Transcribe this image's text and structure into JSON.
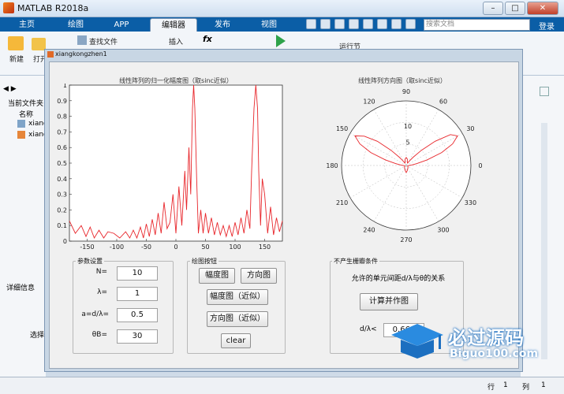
{
  "app": {
    "title": "MATLAB R2018a",
    "tabs": [
      "主页",
      "绘图",
      "APP",
      "编辑器",
      "发布",
      "视图"
    ],
    "active_tab": "编辑器",
    "search_placeholder": "搜索文档",
    "login": "登录",
    "toolstrip": {
      "new": "新建",
      "open": "打开",
      "find_files": "查找文件",
      "insert": "插入",
      "run_section": "运行节"
    },
    "current_folder_label": "当前文件夹",
    "name_col": "名称",
    "files": [
      "xiang",
      "xiang"
    ],
    "details_label": "详细信息",
    "select_hint": "选择",
    "status": {
      "row_label": "行",
      "row": "1",
      "col_label": "列",
      "col": "1"
    }
  },
  "figure": {
    "title": "xiangkongzhen1",
    "amp_plot": {
      "title": "线性阵列的归一化幅度图（取sinc近似）",
      "x_ticks": [
        "-150",
        "-100",
        "-50",
        "0",
        "50",
        "100",
        "150"
      ],
      "y_ticks": [
        "0",
        "0.1",
        "0.2",
        "0.3",
        "0.4",
        "0.5",
        "0.6",
        "0.7",
        "0.8",
        "0.9",
        "1"
      ]
    },
    "polar_plot": {
      "title": "线性阵列方向图（取sinc近似）",
      "angle_labels": [
        "90",
        "60",
        "30",
        "0",
        "330",
        "300",
        "270",
        "240",
        "210",
        "180",
        "150",
        "120"
      ],
      "radial_labels": [
        "5",
        "10"
      ]
    },
    "params": {
      "group_label": "参数设置",
      "N_label": "N=",
      "N_value": "10",
      "lambda_label": "λ=",
      "lambda_value": "1",
      "a_label": "a=d/λ=",
      "a_value": "0.5",
      "theta_label": "θB=",
      "theta_value": "30"
    },
    "buttons": {
      "group_label": "绘图按钮",
      "amp": "幅度图",
      "dir": "方向图",
      "amp_approx": "幅度图（近似）",
      "dir_approx": "方向图（近似）",
      "clear": "clear"
    },
    "grating": {
      "group_label": "不产生栅瓣条件",
      "desc": "允许的单元间距d/λ与θ的关系",
      "compute": "计算并作图",
      "dl_label": "d/λ<",
      "dl_value": "0.666"
    }
  },
  "watermark": {
    "text_cn": "必过源码",
    "text_en": "Biguo100.com"
  },
  "colors": {
    "accent": "#0b5ea6",
    "curve": "#e8262b"
  },
  "chart_data": [
    {
      "type": "line",
      "title": "线性阵列的归一化幅度图（取sinc近似）",
      "xlim": [
        -180,
        180
      ],
      "ylim": [
        0,
        1
      ],
      "series": [
        {
          "x": [
            -180,
            -170,
            -160,
            -152,
            -145,
            -138,
            -130,
            -122,
            -115,
            -105,
            -95,
            -85,
            -78,
            -72,
            -66,
            -60,
            -55,
            -50,
            -45,
            -40,
            -35,
            -30,
            -25,
            -20,
            -15,
            -10,
            -5,
            0,
            5,
            10,
            15,
            18,
            22,
            25,
            28,
            30,
            32,
            35,
            38,
            42,
            46,
            50,
            55,
            60,
            65,
            70,
            75,
            80,
            85,
            90,
            95,
            100,
            105,
            110,
            115,
            120,
            125,
            128,
            132,
            135,
            138,
            140,
            143,
            146,
            150,
            155,
            160,
            165,
            170,
            175,
            180
          ],
          "y": [
            0.13,
            0.05,
            0.1,
            0.03,
            0.09,
            0.02,
            0.07,
            0.02,
            0.06,
            0.05,
            0.02,
            0.06,
            0.02,
            0.07,
            0.02,
            0.09,
            0.02,
            0.11,
            0.03,
            0.14,
            0.04,
            0.18,
            0.05,
            0.25,
            0.08,
            0.12,
            0.3,
            0.05,
            0.35,
            0.1,
            0.45,
            0.2,
            0.6,
            0.3,
            0.85,
            1.0,
            0.85,
            0.4,
            0.05,
            0.2,
            0.05,
            0.18,
            0.05,
            0.15,
            0.04,
            0.12,
            0.04,
            0.1,
            0.03,
            0.1,
            0.03,
            0.12,
            0.04,
            0.15,
            0.05,
            0.2,
            0.08,
            0.45,
            0.85,
            1.0,
            0.85,
            0.45,
            0.1,
            0.4,
            0.3,
            0.05,
            0.22,
            0.04,
            0.15,
            0.06,
            0.13
          ]
        }
      ]
    },
    {
      "type": "line",
      "title": "线性阵列方向图（取sinc近似）",
      "rlim": [
        0,
        12
      ],
      "series": [
        {
          "theta": [
            0,
            5,
            10,
            15,
            20,
            25,
            30,
            35,
            40,
            45,
            50,
            55,
            60,
            70,
            80,
            90,
            100,
            110,
            120,
            125,
            130,
            135,
            140,
            145,
            150,
            155,
            160,
            165,
            170,
            175,
            180,
            200,
            230,
            260,
            270,
            280,
            310,
            340,
            360
          ],
          "r": [
            0.5,
            1.0,
            2.0,
            4.0,
            7.0,
            9.5,
            11.0,
            10.0,
            7.0,
            4.0,
            2.0,
            1.0,
            0.5,
            0.6,
            1.2,
            1.5,
            1.2,
            0.6,
            0.5,
            1.0,
            2.0,
            4.0,
            7.0,
            9.5,
            11.0,
            9.5,
            7.0,
            4.0,
            2.0,
            1.0,
            0.5,
            0.3,
            0.5,
            1.0,
            1.3,
            1.0,
            0.5,
            0.3,
            0.5
          ]
        }
      ]
    }
  ]
}
